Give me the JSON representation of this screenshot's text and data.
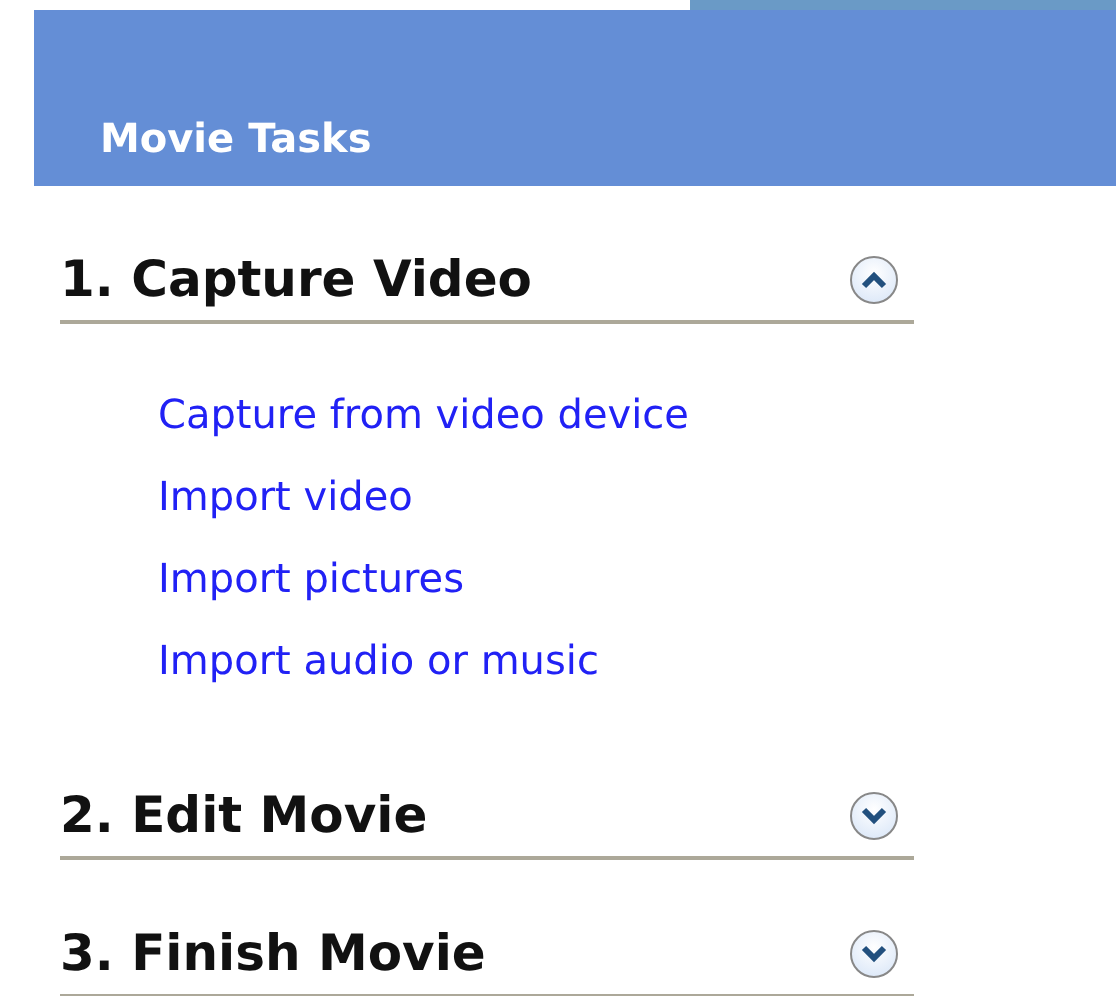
{
  "panel": {
    "title": "Movie Tasks"
  },
  "sections": [
    {
      "title": "1. Capture Video",
      "expanded": true,
      "tasks": [
        "Capture from video device",
        "Import video",
        "Import pictures",
        "Import audio or music"
      ]
    },
    {
      "title": "2. Edit Movie",
      "expanded": false
    },
    {
      "title": "3. Finish Movie",
      "expanded": false
    }
  ]
}
